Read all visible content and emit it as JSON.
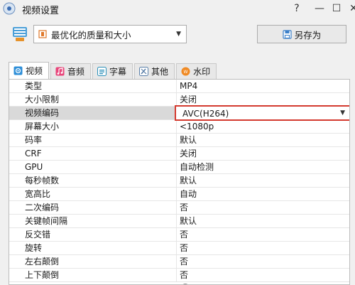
{
  "window": {
    "title": "视频设置",
    "help": "?",
    "minimize": "—",
    "maximize": "☐",
    "close": "✕"
  },
  "toolbar": {
    "preset_value": "最优化的质量和大小",
    "save_as_label": "另存为"
  },
  "tabs": [
    {
      "label": "视频",
      "icon": "video-settings-icon",
      "active": true
    },
    {
      "label": "音频",
      "icon": "music-note-icon",
      "active": false
    },
    {
      "label": "字幕",
      "icon": "subtitle-icon",
      "active": false
    },
    {
      "label": "其他",
      "icon": "tools-icon",
      "active": false
    },
    {
      "label": "水印",
      "icon": "watermark-icon",
      "active": false
    }
  ],
  "properties": [
    {
      "key": "类型",
      "value": "MP4"
    },
    {
      "key": "大小限制",
      "value": "关闭"
    },
    {
      "key": "视频编码",
      "value": "AVC(H264)"
    },
    {
      "key": "屏幕大小",
      "value": "<1080p"
    },
    {
      "key": "码率",
      "value": "默认"
    },
    {
      "key": "CRF",
      "value": "关闭"
    },
    {
      "key": "GPU",
      "value": "自动检测"
    },
    {
      "key": "每秒帧数",
      "value": "默认"
    },
    {
      "key": "宽高比",
      "value": "自动"
    },
    {
      "key": "二次编码",
      "value": "否"
    },
    {
      "key": "关键帧间隔",
      "value": "默认"
    },
    {
      "key": "反交错",
      "value": "否"
    },
    {
      "key": "旋转",
      "value": "否"
    },
    {
      "key": "左右颠倒",
      "value": "否"
    },
    {
      "key": "上下颠倒",
      "value": "否"
    }
  ],
  "colors": {
    "highlight_border": "#d43a2f",
    "selected_row": "#d9d9d9"
  }
}
